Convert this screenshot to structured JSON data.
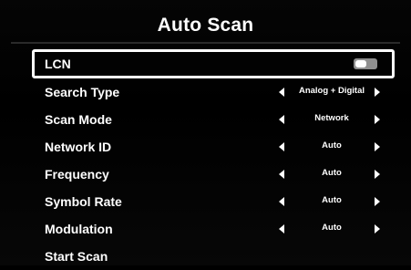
{
  "title": "Auto Scan",
  "rows": [
    {
      "label": "LCN",
      "type": "toggle",
      "state": "off"
    },
    {
      "label": "Search Type",
      "type": "select",
      "value": "Analog + Digital"
    },
    {
      "label": "Scan Mode",
      "type": "select",
      "value": "Network"
    },
    {
      "label": "Network ID",
      "type": "select",
      "value": "Auto"
    },
    {
      "label": "Frequency",
      "type": "select",
      "value": "Auto"
    },
    {
      "label": "Symbol Rate",
      "type": "select",
      "value": "Auto"
    },
    {
      "label": "Modulation",
      "type": "select",
      "value": "Auto"
    },
    {
      "label": "Start Scan",
      "type": "action"
    }
  ],
  "icons": {
    "left": "arrow-left-icon",
    "right": "arrow-right-icon"
  },
  "colors": {
    "background": "#000000",
    "text": "#ffffff",
    "toggle_track": "#8f8f8f",
    "selection_border": "#ffffff"
  }
}
